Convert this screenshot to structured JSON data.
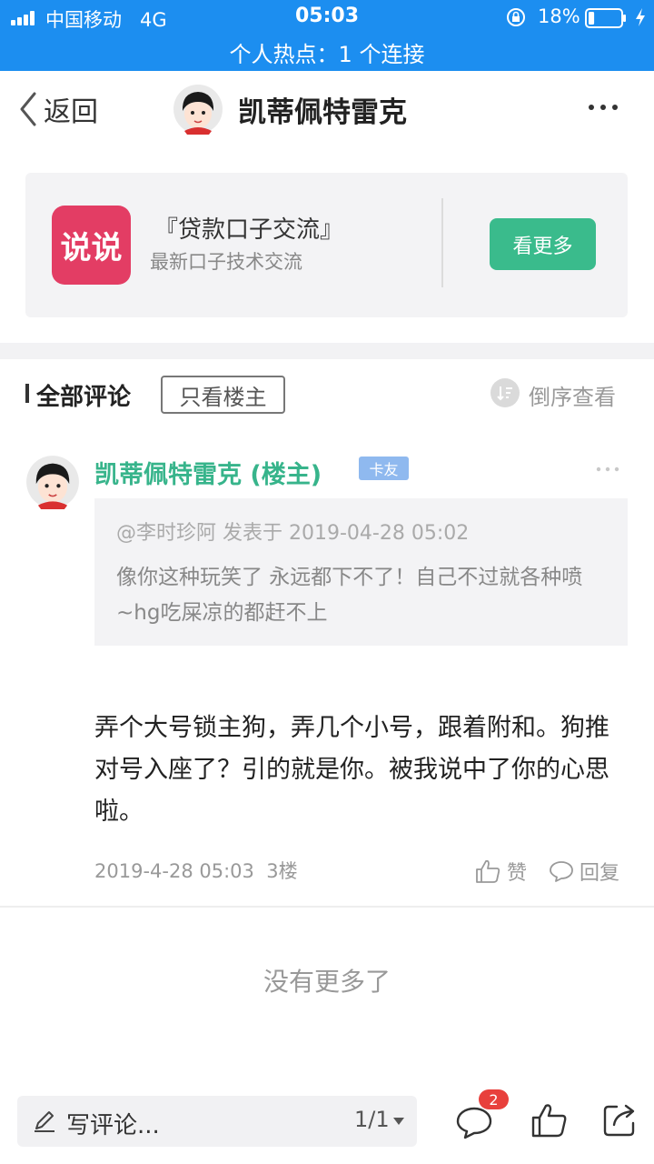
{
  "status_bar": {
    "carrier": "中国移动",
    "network": "4G",
    "time": "05:03",
    "battery": "18%",
    "battery_level": 0.18,
    "hotspot": "个人热点：1 个连接"
  },
  "header": {
    "back_label": "返回",
    "title": "凯蒂佩特雷克"
  },
  "banner": {
    "logo_text": "说说",
    "title": "『贷款口子交流』",
    "subtitle": "最新口子技术交流",
    "button_label": "看更多",
    "accent": "#3abb8c",
    "logo_color": "#e33d64"
  },
  "comments_bar": {
    "title": "全部评论",
    "owner_only": "只看楼主",
    "reverse_label": "倒序查看"
  },
  "comment": {
    "author": "凯蒂佩特雷克 (楼主)",
    "badge": "卡友",
    "quote_meta": "@李时珍阿 发表于 2019-04-28 05:02",
    "quote_text": "像你这种玩笑了  永远都下不了！自己不过就各种喷~hg吃屎凉的都赶不上",
    "body": "弄个大号锁主狗，弄几个小号，跟着附和。狗推对号入座了？引的就是你。被我说中了你的心思啦。",
    "time": "2019-4-28 05:03",
    "floor": "3楼",
    "like_label": "赞",
    "reply_label": "回复",
    "author_color": "#37b48b"
  },
  "no_more": "没有更多了",
  "bottom_bar": {
    "write_placeholder": "写评论...",
    "page_indicator": "1/1",
    "comments_count": "2"
  }
}
